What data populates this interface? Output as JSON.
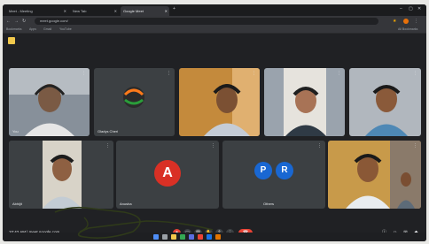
{
  "browser": {
    "tabs": [
      {
        "label": "Meet - Meeting"
      },
      {
        "label": "New Tab"
      },
      {
        "label": "Google Meet"
      }
    ],
    "url": "meet.google.com/",
    "bookmarks": [
      "Bookmarks",
      "Apps",
      "Gmail",
      "YouTube",
      "All Bookmarks"
    ]
  },
  "meeting": {
    "meeting_details": "10:42 AM | meet.google.com",
    "participants": [
      {
        "name": "You",
        "type": "video"
      },
      {
        "name": "Gladys Cheri",
        "type": "logo"
      },
      {
        "name": "",
        "type": "video"
      },
      {
        "name": "",
        "type": "video"
      },
      {
        "name": "",
        "type": "video"
      },
      {
        "name": "Abhijit",
        "type": "video"
      },
      {
        "name": "Anusha",
        "type": "avatar",
        "initial": "A",
        "color": "#d93025"
      },
      {
        "name": "Others",
        "type": "group",
        "initials": [
          "P",
          "R"
        ],
        "color": "#1967d2"
      },
      {
        "name": "",
        "type": "video"
      }
    ],
    "controls": [
      "mic-icon",
      "camera-icon",
      "captions-icon",
      "raise-hand-icon",
      "present-icon",
      "more-icon",
      "end-call-icon"
    ]
  },
  "accent_colors": {
    "end_call": "#ea4335",
    "meet_logo": "#f2c94c"
  }
}
